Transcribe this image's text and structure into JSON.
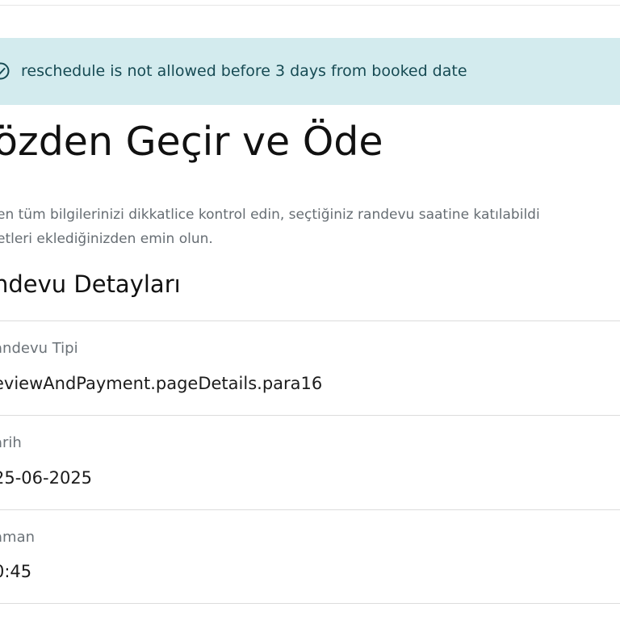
{
  "alert": {
    "icon": "check-circle-icon",
    "message": "reschedule is not allowed before 3 days from booked date",
    "background": "#d3ebee",
    "text_color": "#174b54"
  },
  "page": {
    "title": "özden Geçir ve Öde",
    "description_lines": [
      "en tüm bilgilerinizi dikkatlice kontrol edin, seçtiğiniz randevu saatine katılabildi",
      "etleri eklediğinizden emin olun."
    ]
  },
  "section": {
    "title": "ndevu Detayları"
  },
  "details": [
    {
      "label": "andevu Tipi",
      "value": "eviewAndPayment.pageDetails.para16"
    },
    {
      "label": "arih",
      "value": "25-06-2025"
    },
    {
      "label": "aman",
      "value": "0:45"
    }
  ]
}
